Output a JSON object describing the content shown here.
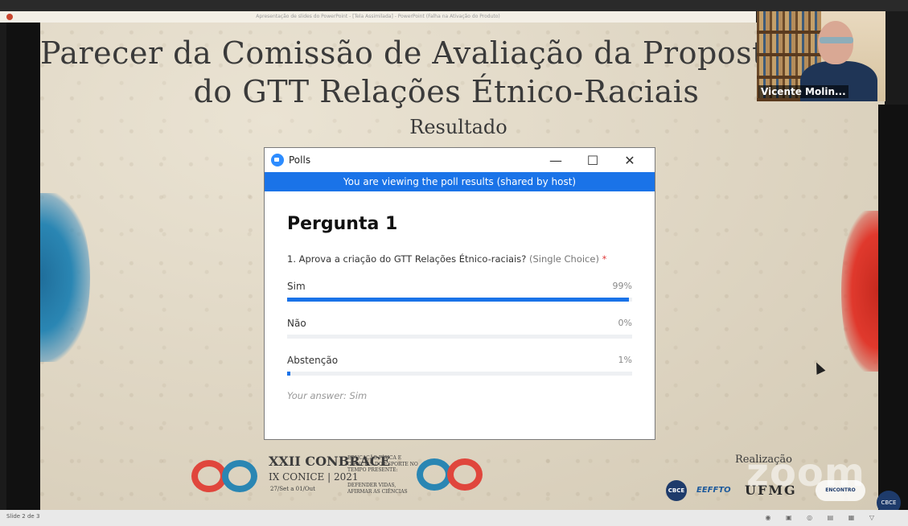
{
  "window": {
    "title_bar_text": "Apresentação de slides do PowerPoint - [Tela Assimilada] - PowerPoint (Falha na Ativação do Produto)"
  },
  "slide": {
    "title_line1": "Parecer da Comissão de Avaliação da Proposta de c",
    "title_line2": "do GTT Relações Étnico-Raciais",
    "subtitle": "Resultado"
  },
  "poll_window": {
    "app_title": "Polls",
    "controls": {
      "minimize": "—",
      "maximize": "☐",
      "close": "✕"
    },
    "banner": "You are viewing the poll results (shared by host)",
    "question_heading": "Pergunta 1",
    "question_text": "1. Aprova a criação do GTT Relações Étnico-raciais?",
    "question_type": "(Single Choice)",
    "required_mark": "*",
    "options": [
      {
        "label": "Sim",
        "percent_text": "99%",
        "fraction": 0.99
      },
      {
        "label": "Não",
        "percent_text": "0%",
        "fraction": 0.0
      },
      {
        "label": "Abstenção",
        "percent_text": "1%",
        "fraction": 0.01
      }
    ],
    "your_answer": "Your answer: Sim",
    "colors": {
      "accent": "#1a73e8",
      "track": "#eef0f3"
    }
  },
  "video": {
    "participant_name": "Vicente Molin..."
  },
  "footer": {
    "conbrace_title": "XXII CONBRACE",
    "conbrace_sub": "IX CONICE | 2021",
    "conbrace_dates": "27/Set a 01/Out",
    "conbrace_tag1": "EDUCAÇÃO FÍSICA E CIÊNCIAS DO ESPORTE NO TEMPO PRESENTE:",
    "conbrace_tag2": "DEFENDER VIDAS, AFIRMAR AS CIÊNCIAS",
    "realizacao": "Realização",
    "zoom_watermark": "zoom",
    "sponsors": {
      "cbce": "CBCE",
      "eefftd": "EEFFTO",
      "ufmg": "UFMG",
      "encontro": "ENCONTRO",
      "seal": "CBCE"
    }
  },
  "status_bar": {
    "slide_counter": "Slide 2 de 3"
  }
}
